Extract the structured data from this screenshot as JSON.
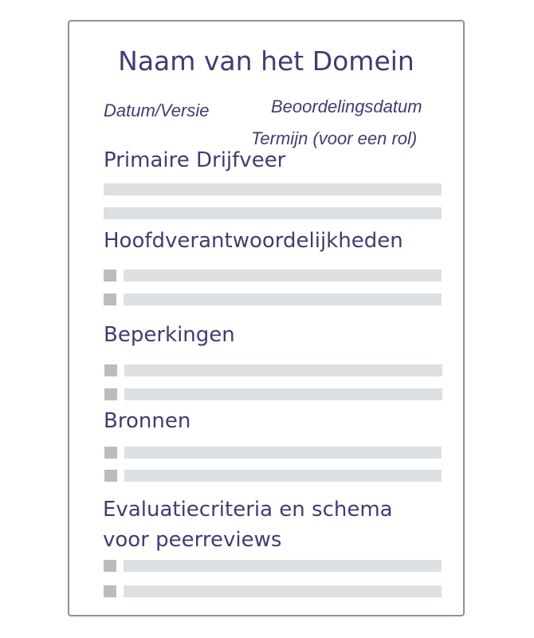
{
  "card": {
    "title": "Naam van het Domein",
    "date_version": "Datum/Versie",
    "review_date": "Beoordelingsdatum",
    "term": "Termijn (voor een rol)",
    "sections": [
      {
        "heading": "Primaire Drijfveer"
      },
      {
        "heading": "Hoofdverantwoordelijkheden"
      },
      {
        "heading": "Beperkingen"
      },
      {
        "heading": "Bronnen"
      },
      {
        "heading_line1": "Evaluatiecriteria en schema",
        "heading_line2": "voor peerreviews"
      }
    ]
  }
}
